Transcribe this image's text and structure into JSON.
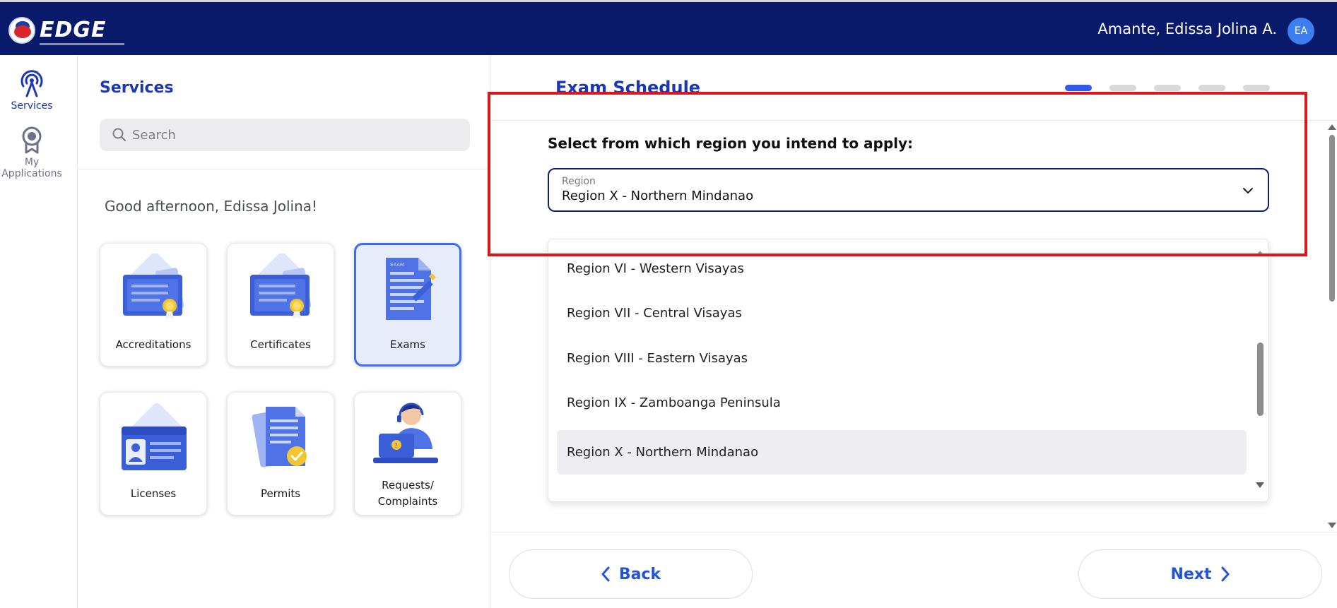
{
  "header": {
    "logo_text": "EDGE",
    "user_name": "Amante, Edissa Jolina A.",
    "avatar_initials": "EA",
    "colors": {
      "bar": "#0a1a6b",
      "avatar": "#3d7ff0"
    }
  },
  "rail": {
    "items": [
      {
        "label": "Services",
        "icon": "antenna-icon",
        "active": true
      },
      {
        "label": "My Applications",
        "icon": "award-icon",
        "active": false
      }
    ]
  },
  "services": {
    "title": "Services",
    "search_placeholder": "Search",
    "greeting": "Good afternoon, Edissa Jolina!",
    "cards": [
      {
        "label": "Accreditations",
        "icon": "certificate-icon"
      },
      {
        "label": "Certificates",
        "icon": "certificate-icon"
      },
      {
        "label": "Exams",
        "icon": "exam-paper-icon",
        "selected": true
      },
      {
        "label": "Licenses",
        "icon": "id-card-icon"
      },
      {
        "label": "Permits",
        "icon": "document-check-icon"
      },
      {
        "label": "Requests/",
        "label2": "Complaints",
        "icon": "support-agent-icon"
      }
    ]
  },
  "exam": {
    "title": "Exam Schedule",
    "steps_total": 5,
    "current_step": 1,
    "question": "Select from which region you intend to apply:",
    "select": {
      "floating_label": "Region",
      "value": "Region X - Northern Mindanao"
    },
    "options": [
      "Region VI - Western Visayas",
      "Region VII - Central Visayas",
      "Region VIII - Eastern Visayas",
      "Region IX - Zamboanga Peninsula",
      "Region X - Northern Mindanao"
    ],
    "highlighted_option": "Region X - Northern Mindanao",
    "back_label": "Back",
    "next_label": "Next",
    "colors": {
      "primary": "#1a37b5",
      "button_text": "#2454d6",
      "annotation_box": "#e0141b"
    }
  }
}
